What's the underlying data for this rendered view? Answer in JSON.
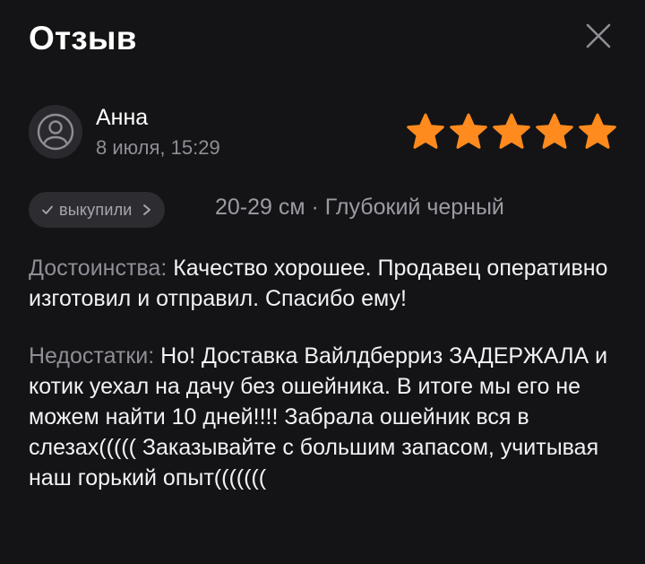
{
  "dialog": {
    "title": "Отзыв",
    "close_icon": "close-icon"
  },
  "review": {
    "author": "Анна",
    "date": "8 июля, 15:29",
    "avatar_icon": "user-icon",
    "rating": 5,
    "rating_max": 5,
    "star_color": "#ff8a1e",
    "badge": {
      "label": "выкупили",
      "check_icon": "check-icon",
      "chevron_icon": "chevron-right-icon"
    },
    "variant": "20-29 см · Глубокий черный",
    "pros_label": "Достоинства:",
    "pros_text": " Качество хорошее. Продавец оперативно изготовил и отправил. Спасибо ему!",
    "cons_label": "Недостатки:",
    "cons_text": " Но! Доставка Вайлдберриз ЗАДЕРЖАЛА и котик уехал на дачу без ошейника. В итоге мы его не можем найти 10 дней!!!! Забрала ошейник вся в слезах((((( Заказывайте с большим запасом, учитывая наш горький опыт((((((("
  },
  "colors": {
    "background": "#141416",
    "text": "#f2f2f4",
    "muted": "#8e8e96",
    "badge_bg": "#2c2c31",
    "accent_star": "#ff8a1e"
  }
}
